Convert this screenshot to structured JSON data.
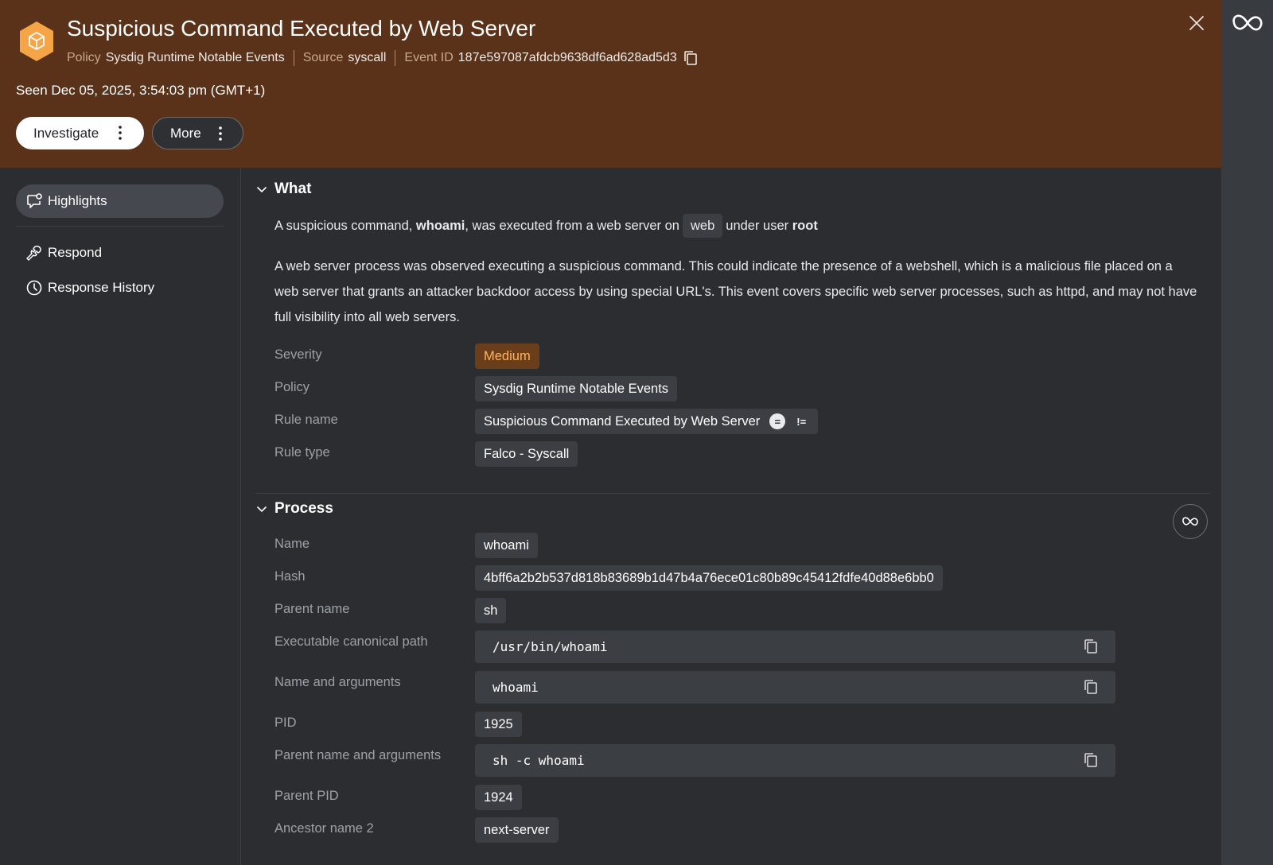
{
  "header": {
    "title": "Suspicious Command Executed by Web Server",
    "policy_label": "Policy",
    "policy_value": "Sysdig Runtime Notable Events",
    "source_label": "Source",
    "source_value": "syscall",
    "event_id_label": "Event ID",
    "event_id_value": "187e597087afdcb9638df6ad628ad5d3",
    "seen": "Seen Dec 05, 2025, 3:54:03 pm (GMT+1)",
    "investigate_label": "Investigate",
    "more_label": "More",
    "icon": "package-cube-icon",
    "accent": "#f5a545",
    "background": "#5a321a"
  },
  "sidebar": {
    "items": [
      {
        "label": "Highlights",
        "icon": "chat-bubble-icon",
        "active": true
      },
      {
        "label": "Respond",
        "icon": "wrench-icon",
        "active": false
      },
      {
        "label": "Response History",
        "icon": "clock-icon",
        "active": false
      }
    ]
  },
  "what": {
    "title": "What",
    "summary": {
      "pre": "A suspicious command, ",
      "command": "whoami",
      "mid": ", was executed from a web server on",
      "host": "web",
      "post": "under user ",
      "user": "root"
    },
    "description": "A web server process was observed executing a suspicious command. This could indicate the presence of a webshell, which is a malicious file placed on a web server that grants an attacker backdoor access by using special URL's. This event covers specific web server processes, such as httpd, and may not have full visibility into all web servers.",
    "fields": {
      "severity": {
        "label": "Severity",
        "value": "Medium",
        "color": "#ffb45c"
      },
      "policy": {
        "label": "Policy",
        "value": "Sysdig Runtime Notable Events"
      },
      "rule_name": {
        "label": "Rule name",
        "value": "Suspicious Command Executed by Web Server",
        "eq": "=",
        "neq": "!="
      },
      "rule_type": {
        "label": "Rule type",
        "value": "Falco - Syscall"
      }
    }
  },
  "process": {
    "title": "Process",
    "fields": {
      "name": {
        "label": "Name",
        "value": "whoami"
      },
      "hash": {
        "label": "Hash",
        "value": "4bff6a2b2b537d818b83689b1d47b4a76ece01c80b89c45412fdfe40d88e6bb0"
      },
      "parent_name": {
        "label": "Parent name",
        "value": "sh"
      },
      "exe_path": {
        "label": "Executable canonical path",
        "value": "/usr/bin/whoami"
      },
      "name_args": {
        "label": "Name and arguments",
        "value": "whoami"
      },
      "pid": {
        "label": "PID",
        "value": "1925"
      },
      "parent_name_args": {
        "label": "Parent name and arguments",
        "value": "sh -c whoami"
      },
      "parent_pid": {
        "label": "Parent PID",
        "value": "1924"
      },
      "ancestor2": {
        "label": "Ancestor name 2",
        "value": "next-server"
      }
    }
  }
}
